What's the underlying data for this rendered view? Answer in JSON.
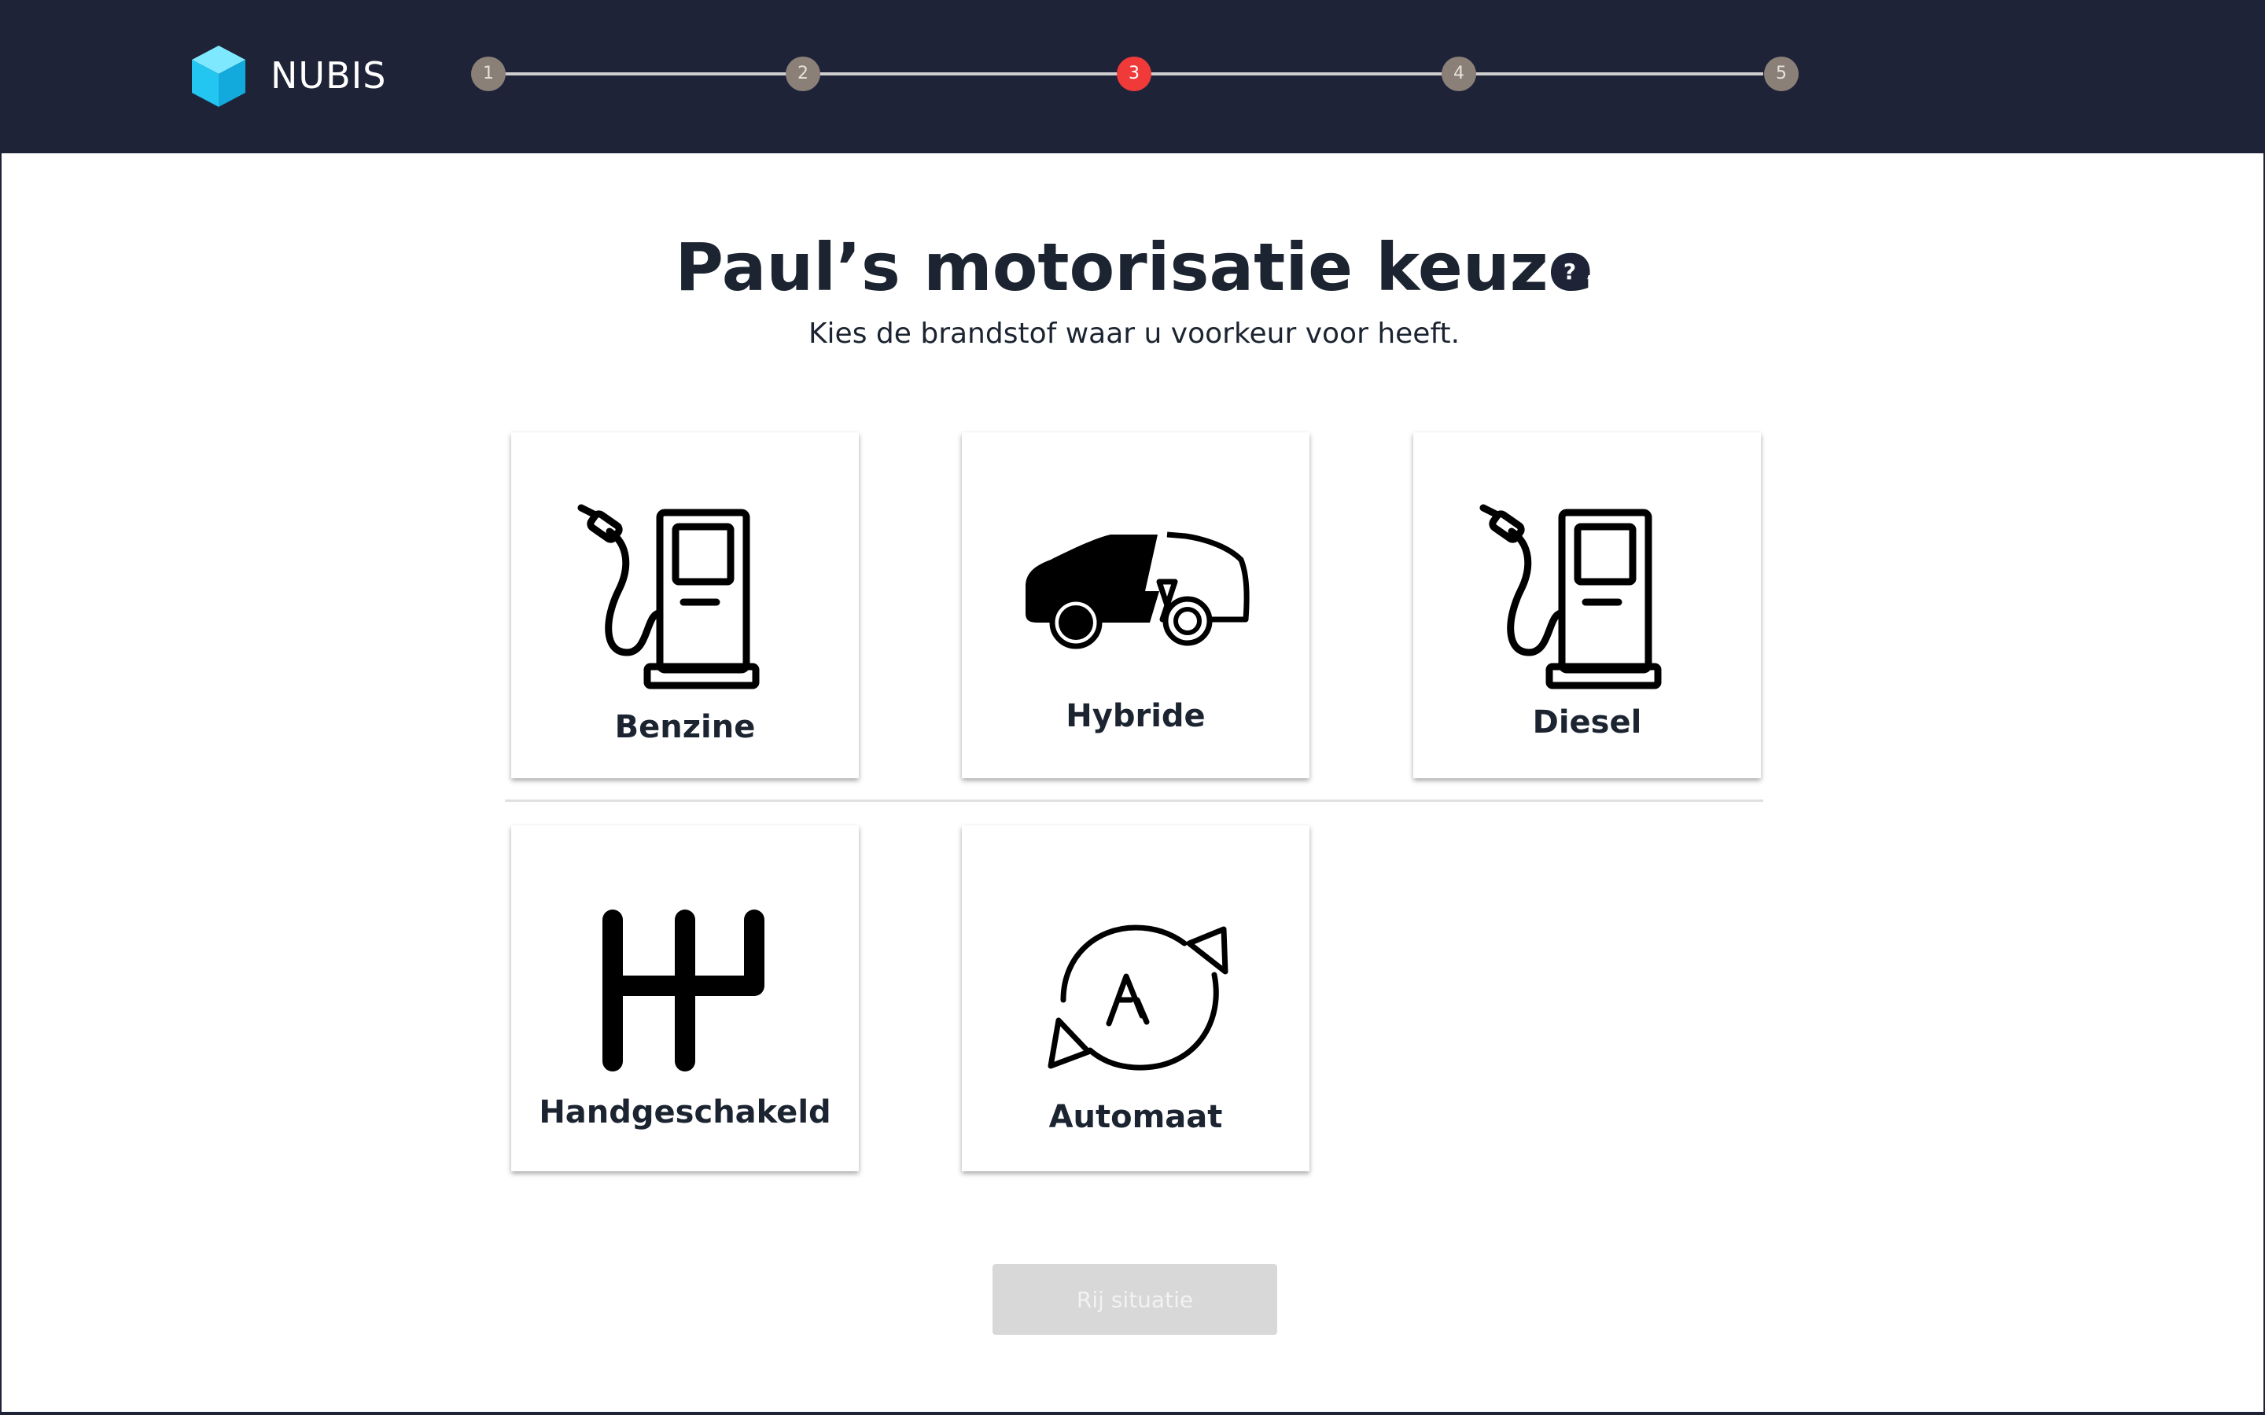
{
  "header": {
    "brand": "NUBIS",
    "steps": [
      "1",
      "2",
      "3",
      "4",
      "5"
    ],
    "active_step": "3"
  },
  "main": {
    "title": "Paul’s motorisatie keuze",
    "help": "?",
    "subtitle": "Kies de brandstof waar u voorkeur voor heeft."
  },
  "fuel_options": [
    {
      "label": "Benzine",
      "icon": "fuel-pump-icon"
    },
    {
      "label": "Hybride",
      "icon": "hybrid-car-icon"
    },
    {
      "label": "Diesel",
      "icon": "fuel-pump-icon"
    }
  ],
  "transmission_options": [
    {
      "label": "Handgeschakeld",
      "icon": "manual-gearshift-icon"
    },
    {
      "label": "Automaat",
      "icon": "automatic-cycle-icon"
    }
  ],
  "footer": {
    "next_label": "Rij situatie"
  },
  "colors": {
    "header_bg": "#1e2338",
    "active_step": "#f03a3a",
    "inactive_step": "#8a8078",
    "logo_cube": "#2bd0f5",
    "button_disabled": "#d8d8d8"
  }
}
